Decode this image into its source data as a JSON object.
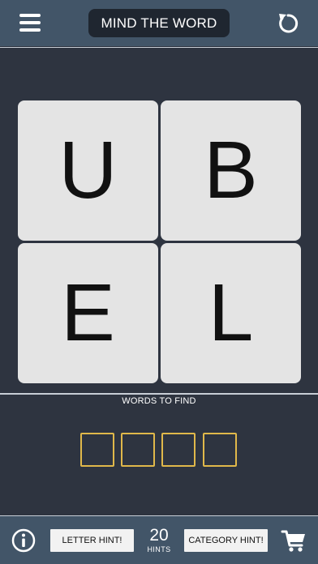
{
  "header": {
    "title": "MIND THE WORD",
    "menu_icon": "hamburger-menu-icon",
    "restart_icon": "restart-icon"
  },
  "board": {
    "tiles": [
      {
        "letter": "U"
      },
      {
        "letter": "B"
      },
      {
        "letter": "E"
      },
      {
        "letter": "L"
      }
    ]
  },
  "answer": {
    "label": "WORDS TO FIND",
    "slot_count": 4,
    "slot_color": "#e0b84a"
  },
  "footer": {
    "info_icon": "info-icon",
    "letter_hint_label": "LETTER HINT!",
    "hints_count": "20",
    "hints_label": "HINTS",
    "category_hint_label": "CATEGORY HINT!",
    "cart_icon": "shopping-cart-icon"
  },
  "colors": {
    "background": "#2e3440",
    "bar": "#425568",
    "tile": "#e4e4e4",
    "accent": "#e0b84a"
  }
}
